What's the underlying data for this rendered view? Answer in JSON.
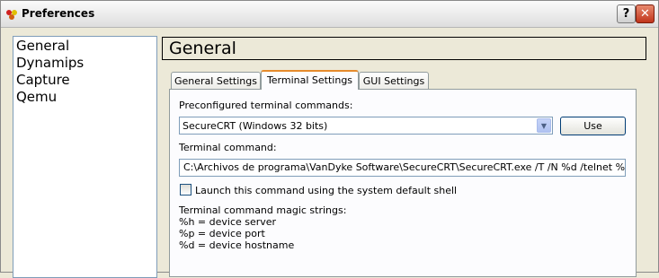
{
  "window": {
    "title": "Preferences",
    "help_label": "?",
    "close_label": "✕"
  },
  "sidebar": {
    "items": [
      {
        "label": "General"
      },
      {
        "label": "Dynamips"
      },
      {
        "label": "Capture"
      },
      {
        "label": "Qemu"
      }
    ]
  },
  "header": {
    "title": "General"
  },
  "tabs": [
    {
      "label": "General Settings"
    },
    {
      "label": "Terminal Settings",
      "active": true
    },
    {
      "label": "GUI Settings"
    }
  ],
  "terminal": {
    "preconfigured_label": "Preconfigured terminal commands:",
    "preconfigured_value": "SecureCRT (Windows 32 bits)",
    "use_label": "Use",
    "command_label": "Terminal command:",
    "command_value": "C:\\Archivos de programa\\VanDyke Software\\SecureCRT\\SecureCRT.exe  /T /N %d  /telnet %h %p",
    "shell_checkbox_label": "Launch this command using the system default shell",
    "shell_checked": false,
    "magic_title": "Terminal command magic strings:",
    "magic_lines": [
      "%h = device server",
      "%p = device port",
      "%d = device hostname"
    ]
  },
  "colors": {
    "accent_tab": "#e68b2c",
    "window_bg": "#ece9d8",
    "close_red": "#c0341b"
  }
}
